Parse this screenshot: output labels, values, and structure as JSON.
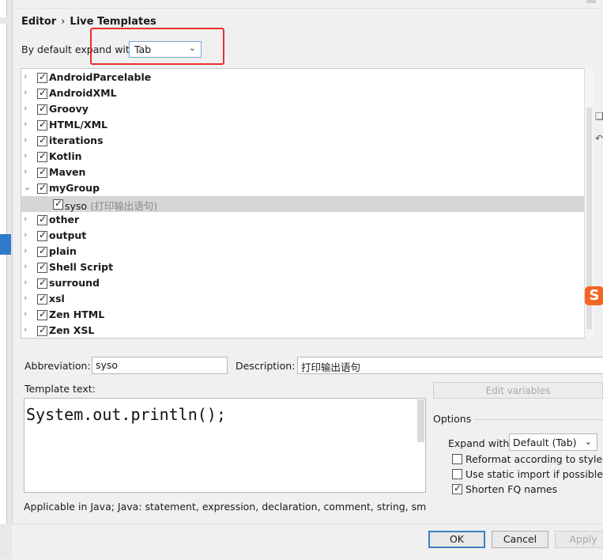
{
  "breadcrumb": {
    "parent": "Editor",
    "separator": "›",
    "current": "Live Templates"
  },
  "expand_default": {
    "label": "By default expand with",
    "value": "Tab"
  },
  "tree": [
    {
      "label": "AndroidParcelable",
      "checked": true,
      "expanded": false
    },
    {
      "label": "AndroidXML",
      "checked": true,
      "expanded": false
    },
    {
      "label": "Groovy",
      "checked": true,
      "expanded": false
    },
    {
      "label": "HTML/XML",
      "checked": true,
      "expanded": false
    },
    {
      "label": "iterations",
      "checked": true,
      "expanded": false
    },
    {
      "label": "Kotlin",
      "checked": true,
      "expanded": false
    },
    {
      "label": "Maven",
      "checked": true,
      "expanded": false
    },
    {
      "label": "myGroup",
      "checked": true,
      "expanded": true
    },
    {
      "label": "syso",
      "description": "(打印输出语句)",
      "checked": true,
      "child": true,
      "selected": true
    },
    {
      "label": "other",
      "checked": true,
      "expanded": false
    },
    {
      "label": "output",
      "checked": true,
      "expanded": false
    },
    {
      "label": "plain",
      "checked": true,
      "expanded": false
    },
    {
      "label": "Shell Script",
      "checked": true,
      "expanded": false
    },
    {
      "label": "surround",
      "checked": true,
      "expanded": false
    },
    {
      "label": "xsl",
      "checked": true,
      "expanded": false
    },
    {
      "label": "Zen HTML",
      "checked": true,
      "expanded": false
    },
    {
      "label": "Zen XSL",
      "checked": true,
      "expanded": false
    }
  ],
  "template": {
    "abbreviation_label": "Abbreviation:",
    "abbreviation_value": "syso",
    "description_label": "Description:",
    "description_value": "打印输出语句",
    "text_label": "Template text:",
    "text_value": "System.out.println();",
    "applicable": "Applicable in Java; Java: statement, expression, declaration, comment, string, smart type"
  },
  "options": {
    "edit_variables_label": "Edit variables",
    "section_label": "Options",
    "expand_with_label": "Expand with",
    "expand_with_value": "Default (Tab)",
    "reformat_label": "Reformat according to style",
    "reformat_checked": false,
    "static_import_label": "Use static import if possible",
    "static_import_checked": false,
    "shorten_fq_label": "Shorten FQ names",
    "shorten_fq_checked": true
  },
  "buttons": {
    "ok": "OK",
    "cancel": "Cancel",
    "apply": "Apply"
  },
  "icons": [
    "chevron-right-icon",
    "chevron-down-icon",
    "checkbox-icon",
    "copy-icon",
    "revert-icon",
    "sogou-ime-icon"
  ],
  "colors": {
    "highlight": "#e8302b",
    "selection": "#d6d6d6",
    "accent": "#2f7bcb"
  }
}
